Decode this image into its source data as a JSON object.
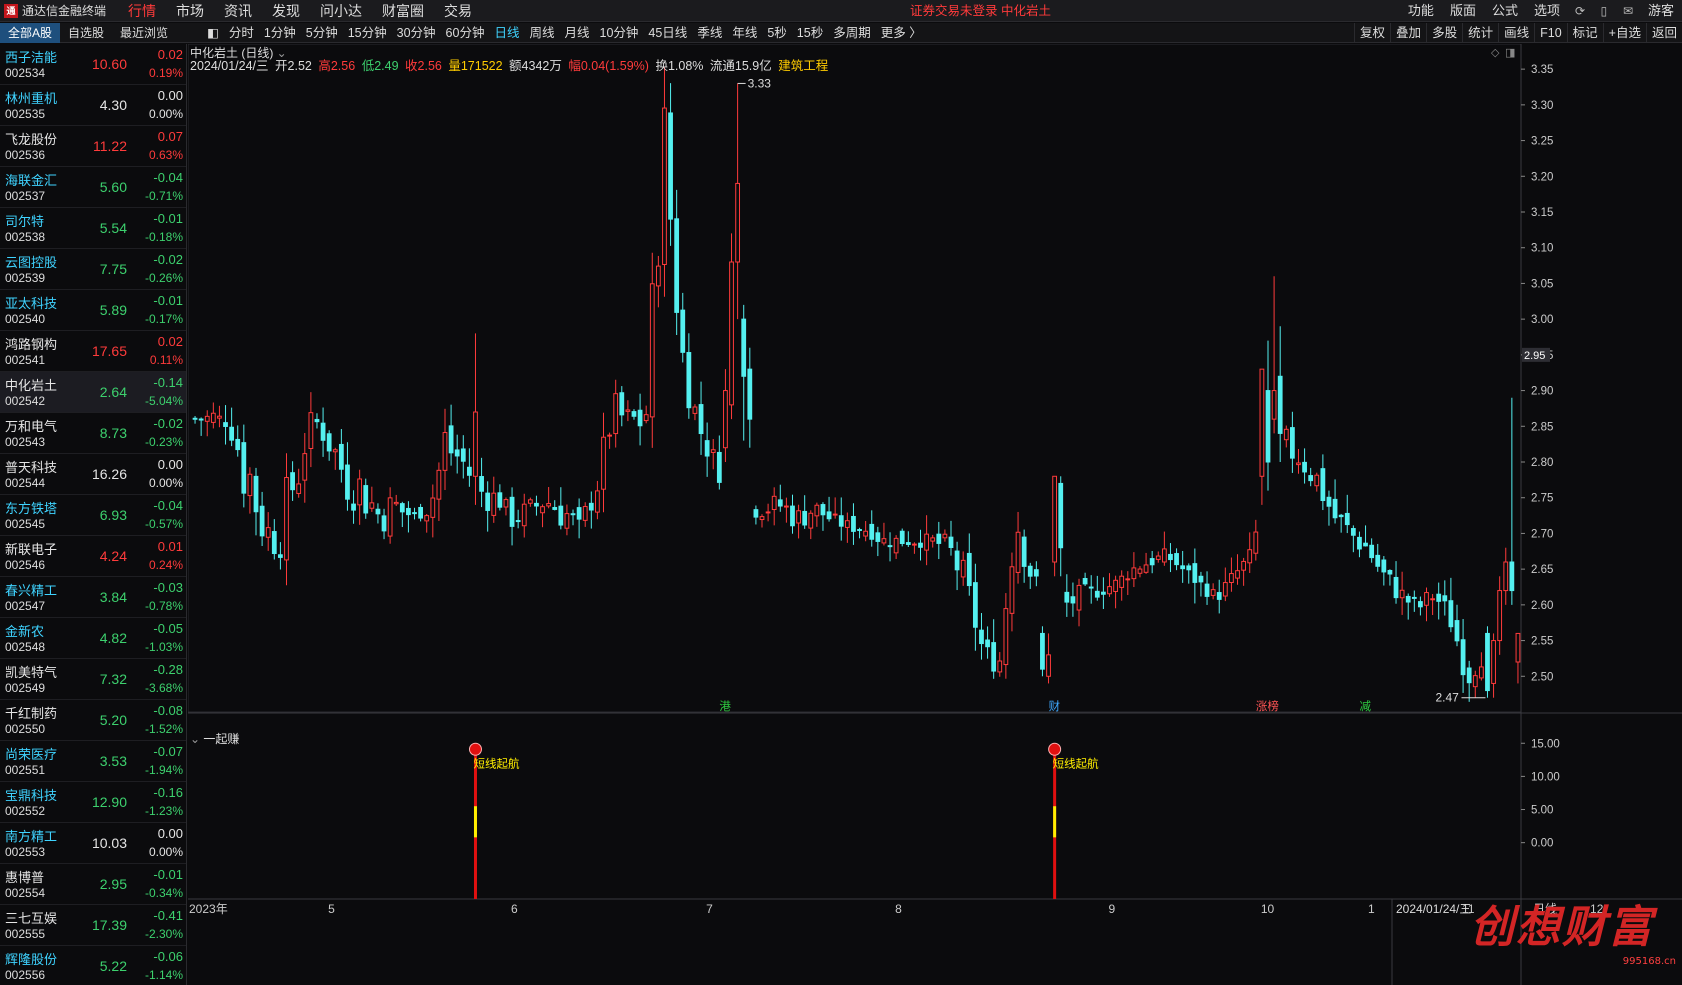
{
  "app": {
    "title": "通达信金融终端",
    "logo_glyph": "通"
  },
  "topmenu": [
    "行情",
    "市场",
    "资讯",
    "发现",
    "问小达",
    "财富圈",
    "交易"
  ],
  "topmenu_active": 0,
  "top_center": "证券交易未登录  中化岩土",
  "top_right": [
    "功能",
    "版面",
    "公式",
    "选项"
  ],
  "top_right_icons": [
    "refresh-icon",
    "phone-icon",
    "mail-icon"
  ],
  "top_right_user": "游客",
  "list_tabs": [
    "全部A股",
    "自选股",
    "最近浏览"
  ],
  "periods": [
    "分时",
    "1分钟",
    "5分钟",
    "15分钟",
    "30分钟",
    "60分钟",
    "日线",
    "周线",
    "月线",
    "10分钟",
    "45日线",
    "季线",
    "年线",
    "5秒",
    "15秒",
    "多周期",
    "更多 〉"
  ],
  "period_active": 6,
  "tools": [
    "复权",
    "叠加",
    "多股",
    "统计",
    "画线",
    "F10",
    "标记",
    "+自选",
    "返回"
  ],
  "stocks": [
    {
      "name": "西子洁能",
      "code": "002534",
      "price": "10.60",
      "chg": "0.02",
      "pct": "0.19%",
      "dir": "up",
      "name_color": "cyan"
    },
    {
      "name": "林州重机",
      "code": "002535",
      "price": "4.30",
      "chg": "0.00",
      "pct": "0.00%",
      "dir": "flat",
      "name_color": "cyan"
    },
    {
      "name": "飞龙股份",
      "code": "002536",
      "price": "11.22",
      "chg": "0.07",
      "pct": "0.63%",
      "dir": "up",
      "name_color": "white"
    },
    {
      "name": "海联金汇",
      "code": "002537",
      "price": "5.60",
      "chg": "-0.04",
      "pct": "-0.71%",
      "dir": "down",
      "name_color": "cyan"
    },
    {
      "name": "司尔特",
      "code": "002538",
      "price": "5.54",
      "chg": "-0.01",
      "pct": "-0.18%",
      "dir": "down",
      "name_color": "cyan"
    },
    {
      "name": "云图控股",
      "code": "002539",
      "price": "7.75",
      "chg": "-0.02",
      "pct": "-0.26%",
      "dir": "down",
      "name_color": "cyan"
    },
    {
      "name": "亚太科技",
      "code": "002540",
      "price": "5.89",
      "chg": "-0.01",
      "pct": "-0.17%",
      "dir": "down",
      "name_color": "cyan"
    },
    {
      "name": "鸿路钢构",
      "code": "002541",
      "price": "17.65",
      "chg": "0.02",
      "pct": "0.11%",
      "dir": "up",
      "name_color": "white"
    },
    {
      "name": "中化岩土",
      "code": "002542",
      "price": "2.64",
      "chg": "-0.14",
      "pct": "-5.04%",
      "dir": "down",
      "name_color": "white",
      "selected": true
    },
    {
      "name": "万和电气",
      "code": "002543",
      "price": "8.73",
      "chg": "-0.02",
      "pct": "-0.23%",
      "dir": "down",
      "name_color": "white"
    },
    {
      "name": "普天科技",
      "code": "002544",
      "price": "16.26",
      "chg": "0.00",
      "pct": "0.00%",
      "dir": "flat",
      "name_color": "white"
    },
    {
      "name": "东方铁塔",
      "code": "002545",
      "price": "6.93",
      "chg": "-0.04",
      "pct": "-0.57%",
      "dir": "down",
      "name_color": "cyan"
    },
    {
      "name": "新联电子",
      "code": "002546",
      "price": "4.24",
      "chg": "0.01",
      "pct": "0.24%",
      "dir": "up",
      "name_color": "white"
    },
    {
      "name": "春兴精工",
      "code": "002547",
      "price": "3.84",
      "chg": "-0.03",
      "pct": "-0.78%",
      "dir": "down",
      "name_color": "cyan"
    },
    {
      "name": "金新农",
      "code": "002548",
      "price": "4.82",
      "chg": "-0.05",
      "pct": "-1.03%",
      "dir": "down",
      "name_color": "cyan"
    },
    {
      "name": "凯美特气",
      "code": "002549",
      "price": "7.32",
      "chg": "-0.28",
      "pct": "-3.68%",
      "dir": "down",
      "name_color": "white"
    },
    {
      "name": "千红制药",
      "code": "002550",
      "price": "5.20",
      "chg": "-0.08",
      "pct": "-1.52%",
      "dir": "down",
      "name_color": "white"
    },
    {
      "name": "尚荣医疗",
      "code": "002551",
      "price": "3.53",
      "chg": "-0.07",
      "pct": "-1.94%",
      "dir": "down",
      "name_color": "cyan"
    },
    {
      "name": "宝鼎科技",
      "code": "002552",
      "price": "12.90",
      "chg": "-0.16",
      "pct": "-1.23%",
      "dir": "down",
      "name_color": "cyan"
    },
    {
      "name": "南方精工",
      "code": "002553",
      "price": "10.03",
      "chg": "0.00",
      "pct": "0.00%",
      "dir": "flat",
      "name_color": "cyan"
    },
    {
      "name": "惠博普",
      "code": "002554",
      "price": "2.95",
      "chg": "-0.01",
      "pct": "-0.34%",
      "dir": "down",
      "name_color": "white"
    },
    {
      "name": "三七互娱",
      "code": "002555",
      "price": "17.39",
      "chg": "-0.41",
      "pct": "-2.30%",
      "dir": "down",
      "name_color": "white"
    },
    {
      "name": "辉隆股份",
      "code": "002556",
      "price": "5.22",
      "chg": "-0.06",
      "pct": "-1.14%",
      "dir": "down",
      "name_color": "cyan"
    }
  ],
  "chart": {
    "title": "中化岩土 (日线)",
    "info": {
      "date": "2024/01/24/三",
      "open": "开2.52",
      "high": "高2.56",
      "low": "低2.49",
      "close": "收2.56",
      "vol": "量171522",
      "amount": "额4342万",
      "amp": "幅0.04(1.59%)",
      "turnover": "换1.08%",
      "float": "流通15.9亿",
      "sector": "建筑工程"
    },
    "current_price_tag": "2.95",
    "high_label": "3.33",
    "low_label": "2.47",
    "event_markers": [
      {
        "label": "港",
        "color": "#2ecc40"
      },
      {
        "label": "财",
        "color": "#3fa9ff"
      },
      {
        "label": "涨榜",
        "color": "#ff5555"
      },
      {
        "label": "减",
        "color": "#2ecc40"
      }
    ],
    "x_labels": [
      "2023年",
      "5",
      "6",
      "7",
      "8",
      "9",
      "10",
      "11",
      "12",
      "1",
      "2024/01/24/三"
    ],
    "period_label": "日线"
  },
  "chart_data": {
    "type": "candlestick",
    "ylim": [
      2.45,
      3.36
    ],
    "y_ticks": [
      "3.35",
      "3.30",
      "3.25",
      "3.20",
      "3.15",
      "3.10",
      "3.05",
      "3.00",
      "2.95",
      "2.90",
      "2.85",
      "2.80",
      "2.75",
      "2.70",
      "2.65",
      "2.60",
      "2.55",
      "2.50"
    ],
    "anchors": [
      [
        2.86,
        2.86
      ],
      [
        2.83,
        2.89
      ],
      [
        2.85,
        2.86
      ],
      [
        2.72,
        2.88
      ],
      [
        2.68,
        2.75
      ],
      [
        2.66,
        2.7
      ],
      [
        2.7,
        2.88
      ],
      [
        2.86,
        2.87
      ],
      [
        2.8,
        2.86
      ],
      [
        2.74,
        2.82
      ],
      [
        2.72,
        2.8
      ],
      [
        2.7,
        2.75
      ],
      [
        2.7,
        2.77
      ],
      [
        2.72,
        2.73
      ],
      [
        2.72,
        2.75
      ],
      [
        2.75,
        2.9
      ],
      [
        2.78,
        2.82
      ],
      [
        2.72,
        2.8
      ],
      [
        2.74,
        2.76
      ],
      [
        2.7,
        2.74
      ],
      [
        2.72,
        2.75
      ],
      [
        2.73,
        2.76
      ],
      [
        2.7,
        2.76
      ],
      [
        2.7,
        2.72
      ],
      [
        2.74,
        2.8
      ],
      [
        2.85,
        2.9
      ],
      [
        2.82,
        2.88
      ],
      [
        2.8,
        2.95
      ],
      [
        3.2,
        3.33
      ],
      [
        2.92,
        3.0
      ],
      [
        2.83,
        2.88
      ],
      [
        2.78,
        2.82
      ],
      [
        2.75,
        2.78
      ],
      [
        2.72,
        2.76
      ],
      [
        2.72,
        2.75
      ],
      [
        2.72,
        2.76
      ],
      [
        2.7,
        2.74
      ],
      [
        2.72,
        2.75
      ],
      [
        2.71,
        2.73
      ],
      [
        2.7,
        2.72
      ],
      [
        2.7,
        2.71
      ],
      [
        2.68,
        2.7
      ],
      [
        2.68,
        2.7
      ],
      [
        2.68,
        2.7
      ],
      [
        2.68,
        2.7
      ],
      [
        2.66,
        2.7
      ],
      [
        2.6,
        2.66
      ],
      [
        2.52,
        2.56
      ],
      [
        2.5,
        2.52
      ],
      [
        2.68,
        2.78
      ],
      [
        2.62,
        2.65
      ],
      [
        2.6,
        2.63
      ],
      [
        2.58,
        2.62
      ],
      [
        2.6,
        2.63
      ],
      [
        2.61,
        2.63
      ],
      [
        2.62,
        2.64
      ],
      [
        2.64,
        2.66
      ],
      [
        2.65,
        2.67
      ],
      [
        2.66,
        2.68
      ],
      [
        2.64,
        2.66
      ],
      [
        2.62,
        2.64
      ],
      [
        2.6,
        2.62
      ],
      [
        2.63,
        2.65
      ],
      [
        2.65,
        2.68
      ],
      [
        2.74,
        2.78
      ],
      [
        2.8,
        2.85
      ],
      [
        2.78,
        2.84
      ],
      [
        2.75,
        2.8
      ],
      [
        2.7,
        2.75
      ],
      [
        2.68,
        2.72
      ],
      [
        2.66,
        2.7
      ],
      [
        2.62,
        2.66
      ],
      [
        2.6,
        2.63
      ],
      [
        2.58,
        2.61
      ],
      [
        2.6,
        2.63
      ],
      [
        2.56,
        2.6
      ],
      [
        2.48,
        2.52
      ],
      [
        2.52,
        2.56
      ],
      [
        2.6,
        2.64
      ],
      [
        2.7,
        2.76
      ]
    ]
  },
  "indicator": {
    "title": "一起赚",
    "y_ticks": [
      "15.00",
      "10.00",
      "5.00",
      "0.00"
    ],
    "ylim": [
      -8.5,
      17.0
    ],
    "signals": [
      {
        "label": "短线起航",
        "value": 15.0
      },
      {
        "label": "短线起航",
        "value": 15.0
      }
    ]
  },
  "watermark": "创想财富",
  "watermark_url": "995168.cn"
}
